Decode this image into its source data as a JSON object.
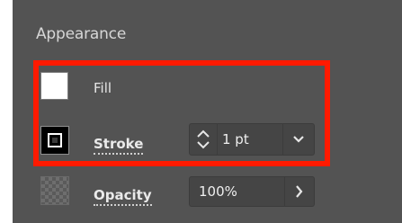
{
  "panel": {
    "title": "Appearance"
  },
  "fill": {
    "label": "Fill",
    "color": "#ffffff"
  },
  "stroke": {
    "label": "Stroke",
    "weight_value": "1 pt",
    "color": "#000000"
  },
  "opacity": {
    "label": "Opacity",
    "value": "100%"
  },
  "colors": {
    "panel_background": "#535353",
    "highlight": "#ff1a00",
    "text": "#e6e6e6"
  },
  "icons": {
    "spinner": "stepper-up-down-icon",
    "dropdown": "chevron-down-icon",
    "opacity_arrow": "chevron-right-icon",
    "opacity_swatch": "checkerboard-icon"
  }
}
